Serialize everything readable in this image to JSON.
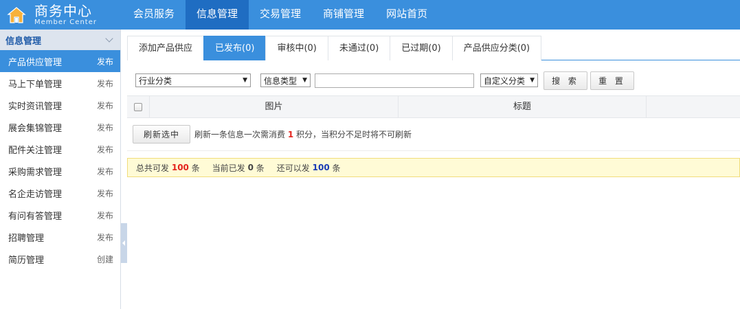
{
  "header": {
    "title": "商务中心",
    "subtitle": "Member Center",
    "nav": [
      "会员服务",
      "信息管理",
      "交易管理",
      "商铺管理",
      "网站首页"
    ],
    "active_nav": 1
  },
  "sidebar": {
    "section_title": "信息管理",
    "items": [
      {
        "label": "产品供应管理",
        "action": "发布"
      },
      {
        "label": "马上下单管理",
        "action": "发布"
      },
      {
        "label": "实时资讯管理",
        "action": "发布"
      },
      {
        "label": "展会集锦管理",
        "action": "发布"
      },
      {
        "label": "配件关注管理",
        "action": "发布"
      },
      {
        "label": "采购需求管理",
        "action": "发布"
      },
      {
        "label": "名企走访管理",
        "action": "发布"
      },
      {
        "label": "有问有答管理",
        "action": "发布"
      },
      {
        "label": "招聘管理",
        "action": "发布"
      },
      {
        "label": "简历管理",
        "action": "创建"
      }
    ]
  },
  "tabs": [
    "添加产品供应",
    "已发布(0)",
    "审核中(0)",
    "未通过(0)",
    "已过期(0)",
    "产品供应分类(0)"
  ],
  "filters": {
    "industry_select": "行业分类",
    "info_type_select": "信息类型",
    "keyword_value": "",
    "custom_category_select": "自定义分类",
    "search_label": "搜 索",
    "reset_label": "重 置"
  },
  "table": {
    "columns": [
      "图片",
      "标题"
    ]
  },
  "refresh": {
    "button_label": "刷新选中",
    "note_prefix": "刷新一条信息一次需消费",
    "cost": "1",
    "note_suffix": "积分，当积分不足时将不可刷新"
  },
  "quota": {
    "total_label": "总共可发",
    "total_value": "100",
    "total_unit": "条",
    "current_label": "当前已发",
    "current_value": "0",
    "current_unit": "条",
    "remaining_label": "还可以发",
    "remaining_value": "100",
    "remaining_unit": "条"
  },
  "colors": {
    "brand_blue": "#3a8fdd",
    "active_nav_blue": "#1f6dc2",
    "highlight_red": "#e4231d",
    "highlight_blue": "#1a3bb5",
    "notice_bg": "#fffbd6"
  }
}
